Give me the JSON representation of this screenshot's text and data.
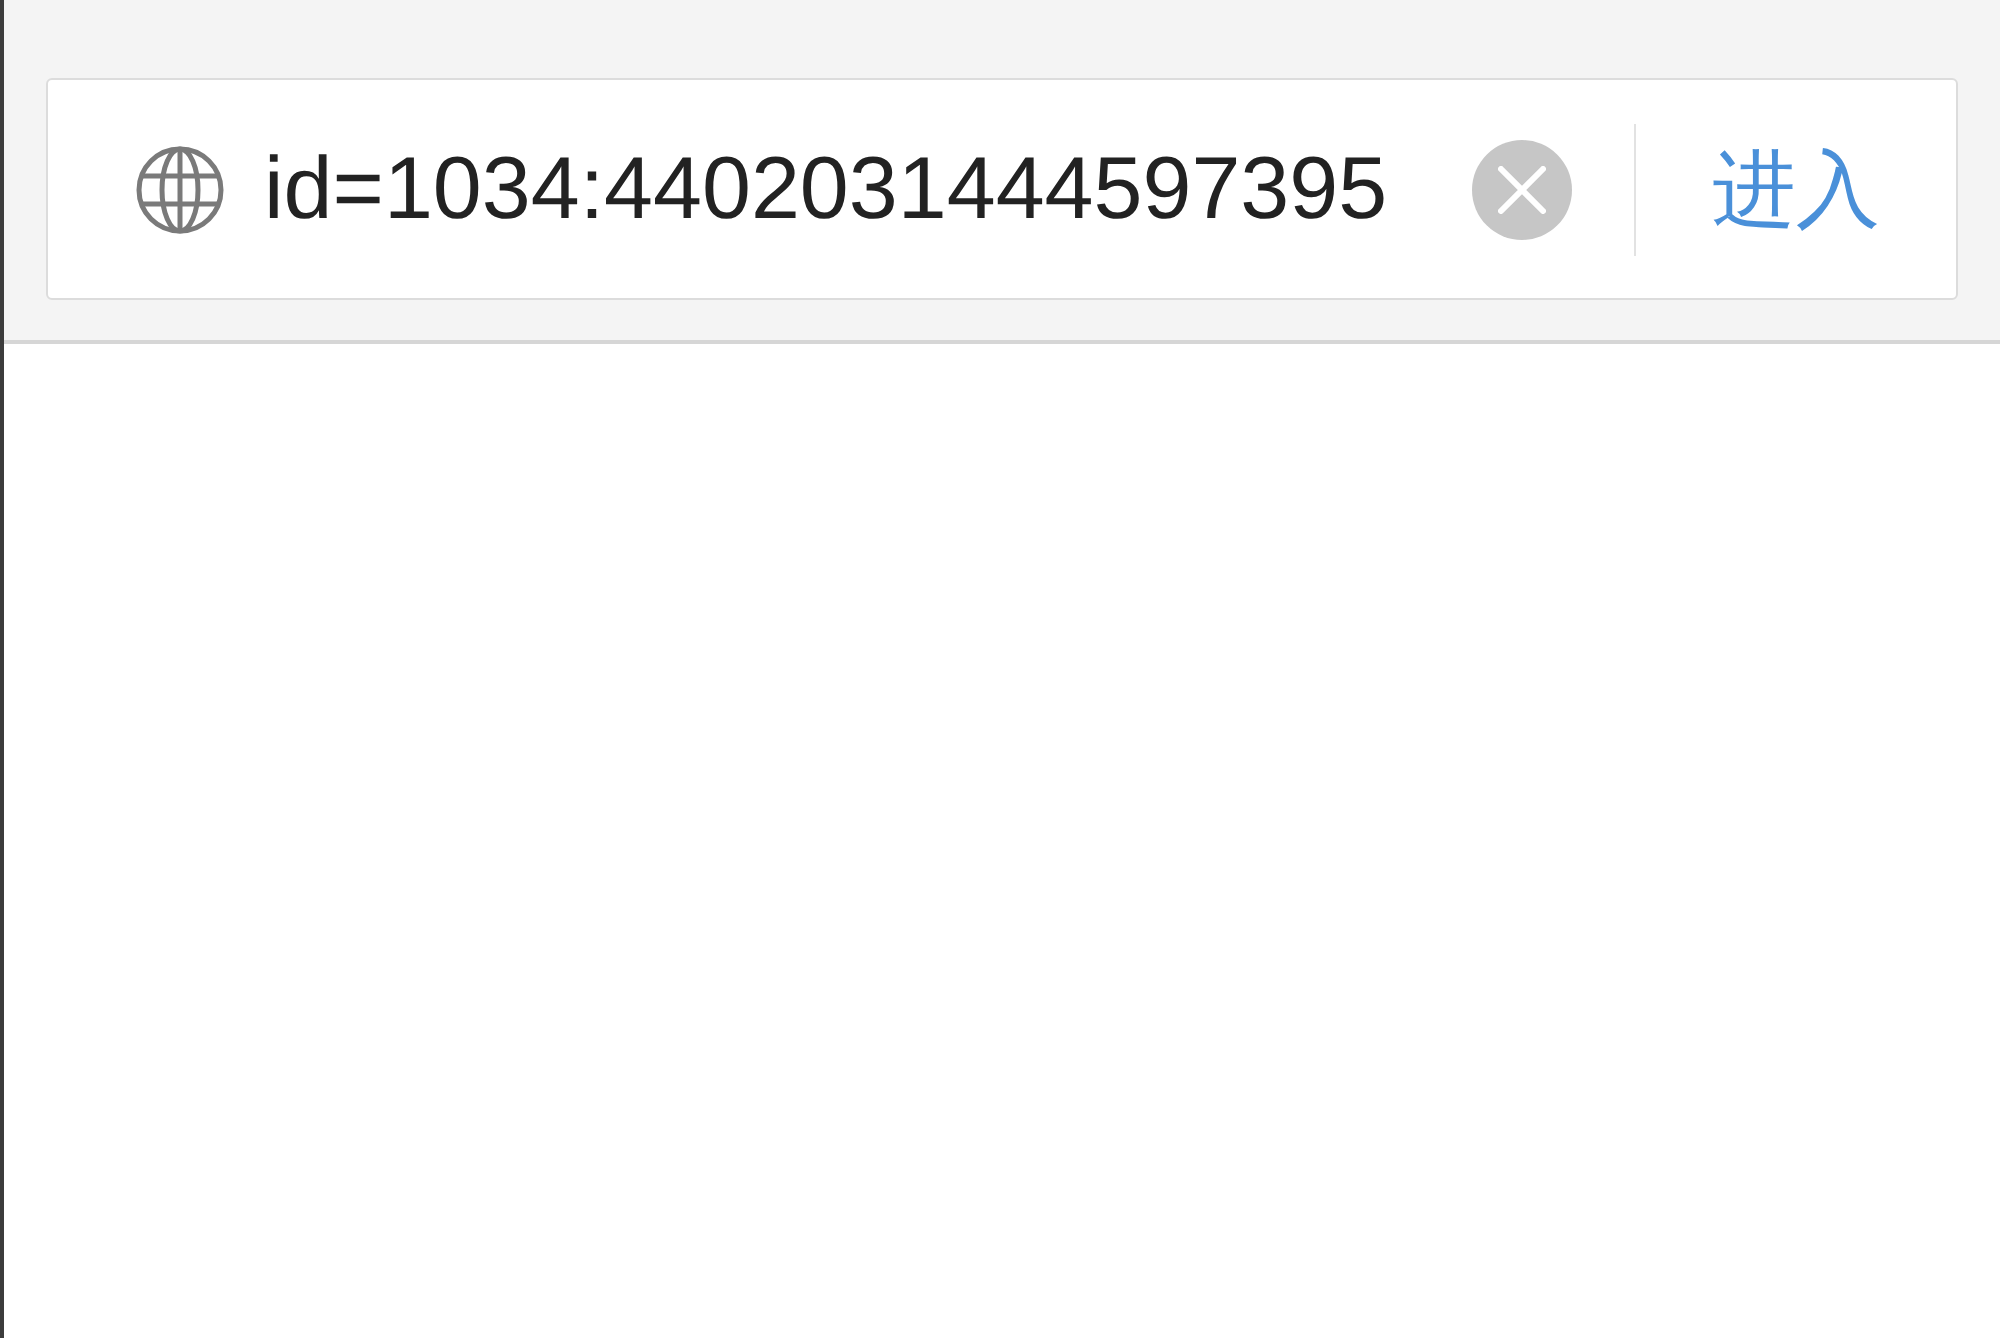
{
  "address_bar": {
    "value": "id=1034:4402031444597395",
    "enter_button": "进入"
  }
}
